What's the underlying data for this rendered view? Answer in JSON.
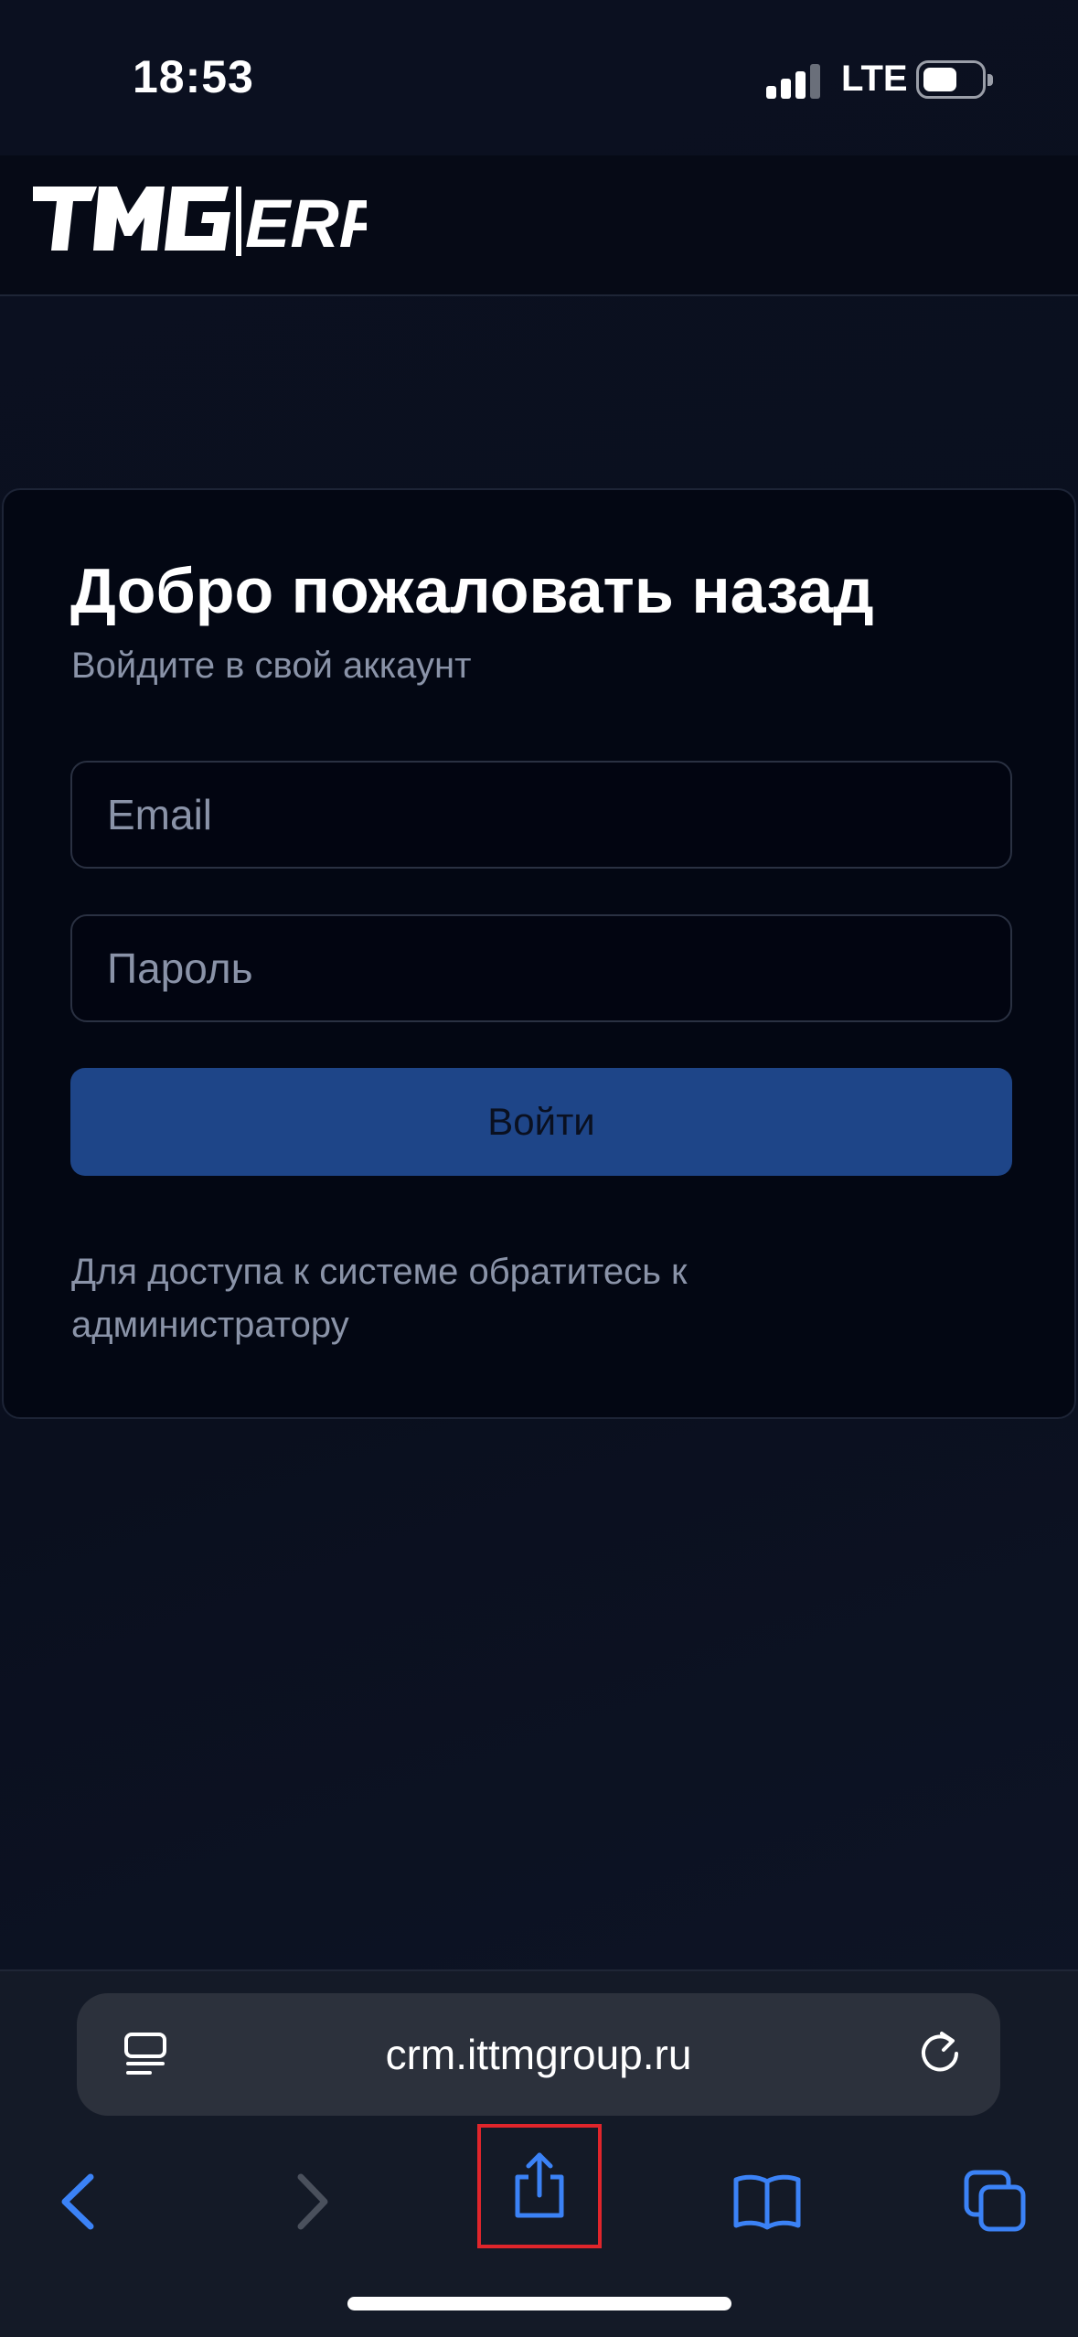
{
  "status_bar": {
    "time": "18:53",
    "network": "LTE",
    "icons": [
      "cellular-signal-icon",
      "battery-icon"
    ]
  },
  "header": {
    "logo_text_main": "TMG",
    "logo_text_sub": "ERP"
  },
  "login": {
    "title": "Добро пожаловать назад",
    "subtitle": "Войдите в свой аккаунт",
    "email_placeholder": "Email",
    "password_placeholder": "Пароль",
    "submit_label": "Войти",
    "note": "Для доступа к системе обратитесь к администратору"
  },
  "browser": {
    "url": "crm.ittmgroup.ru",
    "toolbar_icons": [
      "reader-icon",
      "reload-icon",
      "back-icon",
      "forward-icon",
      "share-icon",
      "bookmarks-icon",
      "tabs-icon"
    ]
  },
  "colors": {
    "background": "#0a0f1e",
    "card": "#030713",
    "accent": "#1e4588",
    "safari_blue": "#3b82f6",
    "highlight": "#e0252b"
  }
}
